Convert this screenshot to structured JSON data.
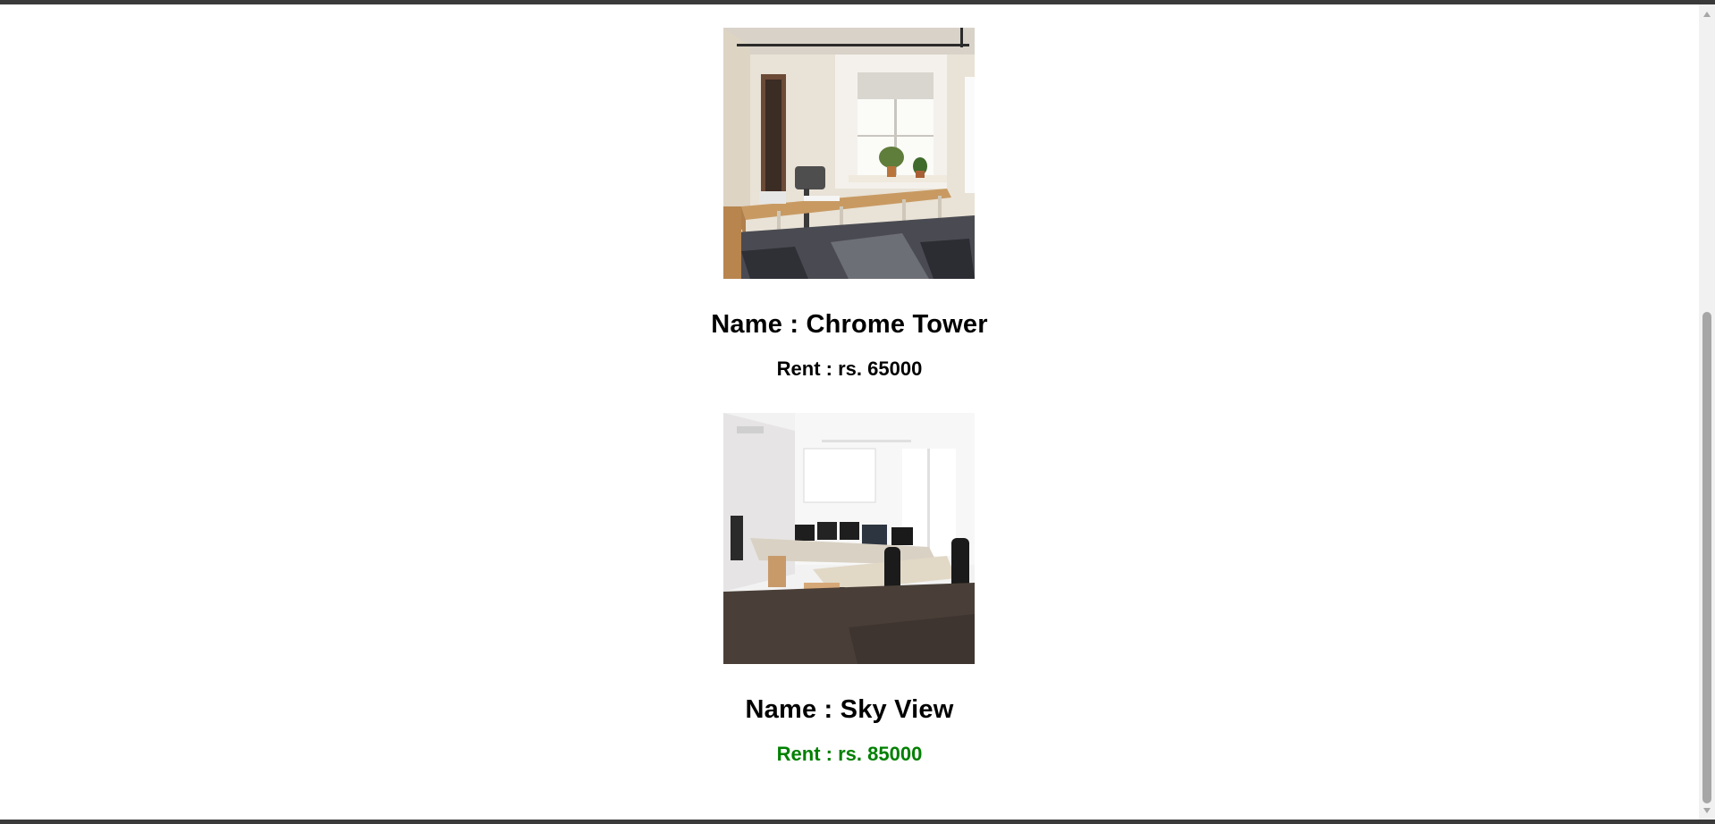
{
  "listings": [
    {
      "name": "Name : Chrome Tower",
      "rent": "Rent : rs. 65000",
      "rent_color": "#000000",
      "image": "office-room-with-window-photo"
    },
    {
      "name": "Name : Sky View",
      "rent": "Rent : rs. 85000",
      "rent_color": "#008000",
      "image": "open-office-with-desks-photo"
    }
  ],
  "scrollbar": {
    "up_icon": "scroll-up-arrow-icon",
    "down_icon": "scroll-down-arrow-icon"
  }
}
